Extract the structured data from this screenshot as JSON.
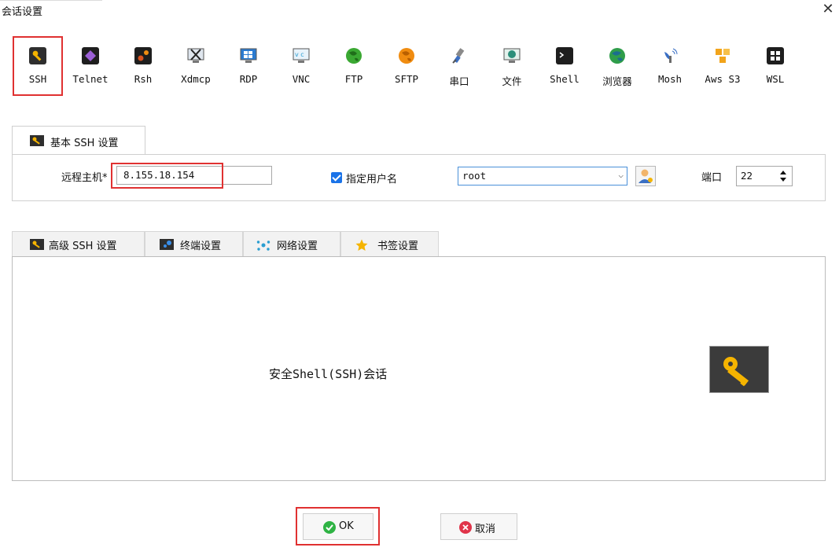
{
  "window": {
    "title": "会话设置",
    "close": "✕"
  },
  "protocols": [
    {
      "label": "SSH",
      "icon": "key-icon",
      "color": "#2e2e2e",
      "selected": true
    },
    {
      "label": "Telnet",
      "icon": "telnet-icon",
      "color": "#6a3fa0"
    },
    {
      "label": "Rsh",
      "icon": "rsh-icon",
      "color": "#d9531e"
    },
    {
      "label": "Xdmcp",
      "icon": "xdmcp-icon",
      "color": "#555555"
    },
    {
      "label": "RDP",
      "icon": "rdp-icon",
      "color": "#2a7bd1"
    },
    {
      "label": "VNC",
      "icon": "vnc-icon",
      "color": "#2a9ed1"
    },
    {
      "label": "FTP",
      "icon": "ftp-globe-icon",
      "color": "#3aa832"
    },
    {
      "label": "SFTP",
      "icon": "sftp-globe-icon",
      "color": "#f08c10"
    },
    {
      "label": "串口",
      "icon": "serial-plug-icon",
      "color": "#7a7a7a"
    },
    {
      "label": "文件",
      "icon": "file-monitor-icon",
      "color": "#2b8f7a"
    },
    {
      "label": "Shell",
      "icon": "terminal-icon",
      "color": "#1e1e1e"
    },
    {
      "label": "浏览器",
      "icon": "browser-globe-icon",
      "color": "#2f9d4a"
    },
    {
      "label": "Mosh",
      "icon": "satellite-icon",
      "color": "#3a6fc4"
    },
    {
      "label": "Aws S3",
      "icon": "aws-cubes-icon",
      "color": "#f2a41b"
    },
    {
      "label": "WSL",
      "icon": "windows-icon",
      "color": "#1e1e1e"
    }
  ],
  "basic_tab": {
    "label": "基本 SSH 设置"
  },
  "basic": {
    "host_label": "远程主机",
    "host_required_mark": "*",
    "host_value": "8.155.18.154",
    "user_checkbox_label": "指定用户名",
    "user_checked": true,
    "username": "root",
    "port_label": "端口",
    "port_value": "22"
  },
  "adv_tabs": [
    {
      "label": "高级 SSH 设置",
      "icon": "key-icon"
    },
    {
      "label": "终端设置",
      "icon": "terminal-settings-icon"
    },
    {
      "label": "网络设置",
      "icon": "network-icon"
    },
    {
      "label": "书签设置",
      "icon": "star-icon"
    }
  ],
  "description": "安全Shell(SSH)会话",
  "buttons": {
    "ok": "OK",
    "cancel": "取消"
  },
  "colors": {
    "accent_red": "#e03131",
    "checkbox_blue": "#1a73e8",
    "ok_green": "#2fb344",
    "cancel_red": "#e0344a",
    "key_yellow": "#f5b400"
  }
}
